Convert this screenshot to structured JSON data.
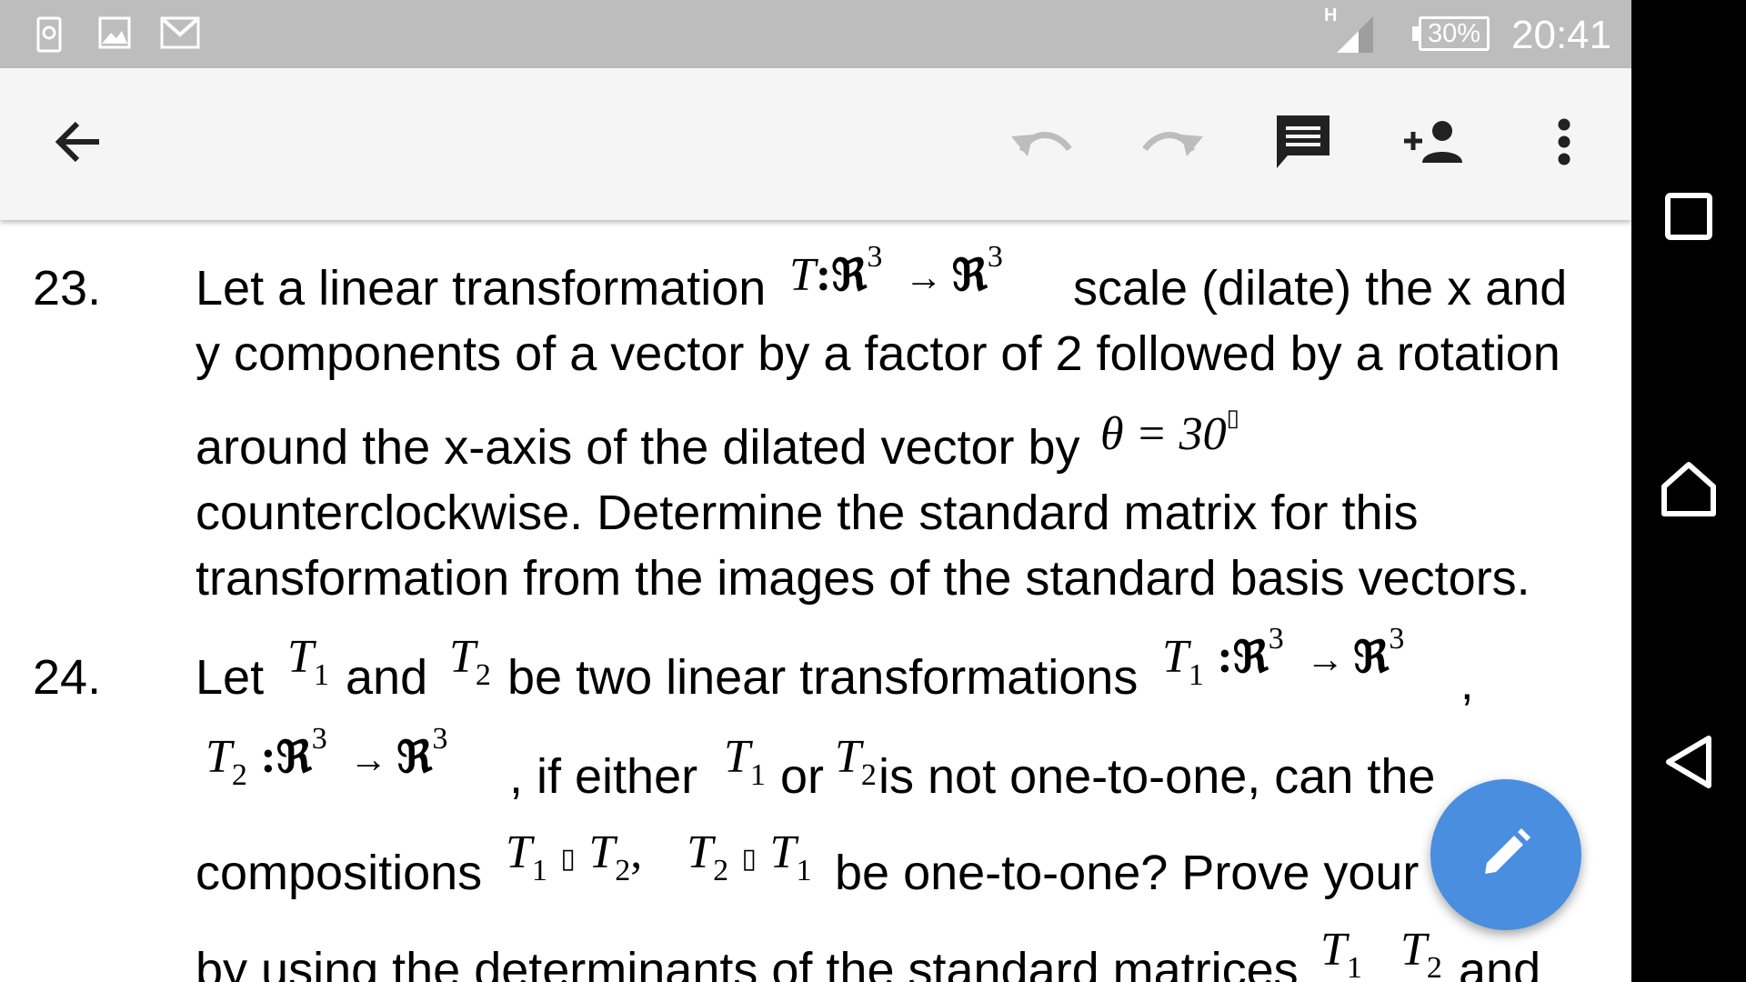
{
  "status_bar": {
    "network_type": "H",
    "battery": "30%",
    "time": "20:41",
    "notification_icons": [
      "browser-icon",
      "image-icon",
      "gmail-icon"
    ]
  },
  "toolbar": {
    "back_icon": "arrow-left-icon",
    "undo_icon": "undo-icon",
    "redo_icon": "redo-icon",
    "comment_icon": "comment-icon",
    "share_icon": "add-person-icon",
    "more_icon": "more-vert-icon"
  },
  "navigation_bar": {
    "recents_icon": "square-icon",
    "home_icon": "circle-home-icon",
    "back_icon": "triangle-back-icon"
  },
  "document": {
    "items": [
      {
        "number": "23.",
        "line1_a": "Let a linear transformation",
        "line1_b": "scale (dilate) the x and",
        "line2": "y components of a vector by a factor of 2 followed by a rotation",
        "line3": "around the x-axis of the dilated vector by",
        "line4": "counterclockwise. Determine the standard matrix for this",
        "line5": "transformation from the images of the standard basis vectors."
      },
      {
        "number": "24.",
        "line1_a": "Let",
        "line1_b": "and",
        "line1_c": "be two linear transformations",
        "line2_a": ", if either",
        "line2_b": "or",
        "line2_c": "is not one-to-one, can the",
        "line3_a": "compositions",
        "line3_b": "be one-to-one? Prove your",
        "line4_a": "by using the determinants of the standard matrices",
        "line4_b": "and"
      }
    ],
    "math": {
      "T": "T",
      "colon": ":",
      "R": "ℜ",
      "exp3": "3",
      "arrow": "→",
      "theta_eq": "θ = 30",
      "degree_box": "▯",
      "sub1": "1",
      "sub2": "2",
      "comma": ",",
      "compose_box": "▯"
    }
  },
  "fab": {
    "icon": "pencil-icon"
  }
}
